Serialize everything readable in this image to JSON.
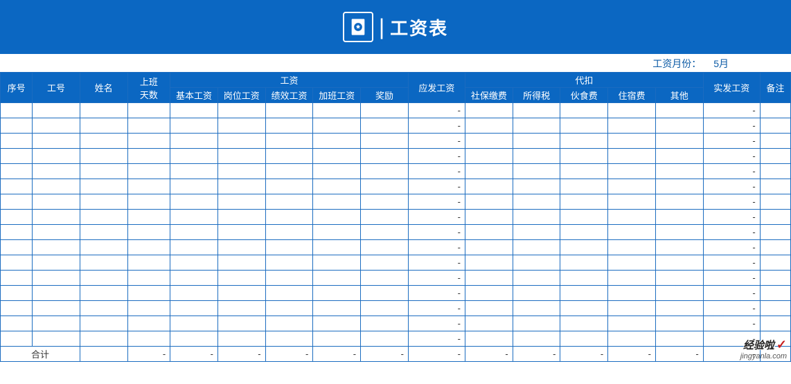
{
  "banner": {
    "title": "工资表"
  },
  "month": {
    "label": "工资月份：",
    "value": "5月"
  },
  "headers": {
    "seq": "序号",
    "empno": "工号",
    "name": "姓名",
    "workdays": "上班\n天数",
    "salary_group": "工资",
    "basic": "基本工资",
    "post": "岗位工资",
    "perf": "绩效工资",
    "ot": "加班工资",
    "bonus": "奖励",
    "gross": "应发工资",
    "deduct_group": "代扣",
    "social": "社保缴费",
    "tax": "所得税",
    "meal": "伙食费",
    "dorm": "住宿费",
    "other": "其他",
    "net": "实发工资",
    "remark": "备注"
  },
  "dash": "-",
  "row_count": 16,
  "total_label": "合计",
  "watermark": {
    "line1": "经验啦",
    "line2": "jingyanla.com"
  }
}
